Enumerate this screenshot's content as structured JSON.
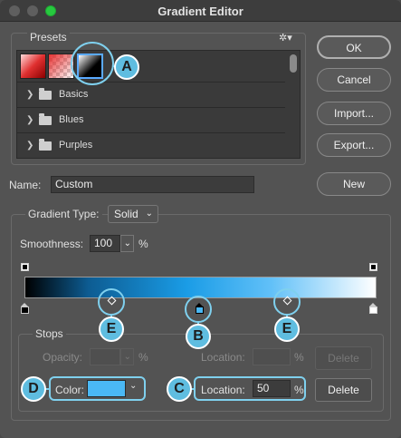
{
  "window": {
    "title": "Gradient Editor"
  },
  "presets": {
    "label": "Presets",
    "gear_glyph": "✲▾",
    "folders": [
      {
        "label": "Basics"
      },
      {
        "label": "Blues"
      },
      {
        "label": "Purples"
      }
    ]
  },
  "buttons": {
    "ok": "OK",
    "cancel": "Cancel",
    "import": "Import...",
    "export": "Export...",
    "new": "New",
    "delete_opacity": "Delete",
    "delete_color": "Delete"
  },
  "name": {
    "label": "Name:",
    "value": "Custom"
  },
  "gradient_type": {
    "label": "Gradient Type:",
    "value": "Solid"
  },
  "smoothness": {
    "label": "Smoothness:",
    "value": "100",
    "unit": "%"
  },
  "stops": {
    "label": "Stops",
    "opacity_label": "Opacity:",
    "opacity_unit": "%",
    "opacity_location_label": "Location:",
    "opacity_location_unit": "%",
    "color_label": "Color:",
    "color_value": "#4ab8f5",
    "location_label": "Location:",
    "location_value": "50",
    "location_unit": "%"
  },
  "callouts": {
    "a": "A",
    "b": "B",
    "c": "C",
    "d": "D",
    "e1": "E",
    "e2": "E"
  },
  "colors": {
    "accent": "#7fd0ee",
    "callout_fill": "#5fbde0",
    "gradient_stops": [
      "#000000",
      "#1a9ce6",
      "#ffffff"
    ]
  }
}
